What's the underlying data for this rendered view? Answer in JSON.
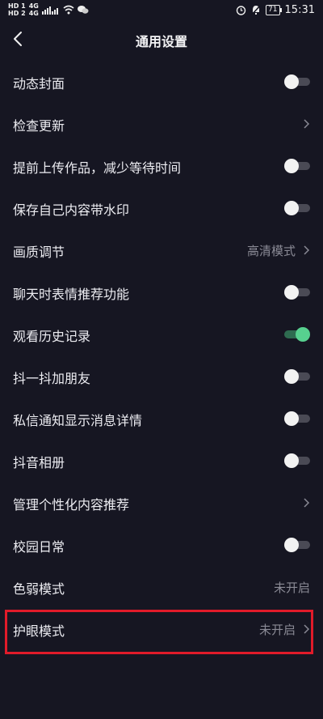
{
  "status_bar": {
    "hd_top": "HD 1",
    "hd_bottom": "HD 2",
    "net_top": "4G",
    "net_bottom": "4G",
    "battery": "71",
    "time": "15:31"
  },
  "header": {
    "title": "通用设置"
  },
  "settings": [
    {
      "label": "动态封面",
      "type": "toggle",
      "on": false
    },
    {
      "label": "检查更新",
      "type": "link",
      "value": ""
    },
    {
      "label": "提前上传作品，减少等待时间",
      "type": "toggle",
      "on": false
    },
    {
      "label": "保存自己内容带水印",
      "type": "toggle",
      "on": false
    },
    {
      "label": "画质调节",
      "type": "link",
      "value": "高清模式"
    },
    {
      "label": "聊天时表情推荐功能",
      "type": "toggle",
      "on": false
    },
    {
      "label": "观看历史记录",
      "type": "toggle",
      "on": true
    },
    {
      "label": "抖一抖加朋友",
      "type": "toggle",
      "on": false
    },
    {
      "label": "私信通知显示消息详情",
      "type": "toggle",
      "on": false
    },
    {
      "label": "抖音相册",
      "type": "toggle",
      "on": false
    },
    {
      "label": "管理个性化内容推荐",
      "type": "link",
      "value": ""
    },
    {
      "label": "校园日常",
      "type": "toggle",
      "on": false
    },
    {
      "label": "色弱模式",
      "type": "value",
      "value": "未开启"
    },
    {
      "label": "护眼模式",
      "type": "link",
      "value": "未开启"
    }
  ],
  "colors": {
    "background": "#161622",
    "toggle_on": "#57d08f",
    "highlight": "#e11b2a"
  }
}
